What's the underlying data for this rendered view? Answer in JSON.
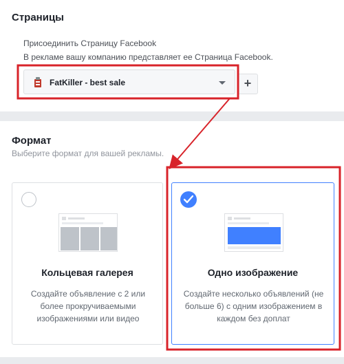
{
  "pages": {
    "title": "Страницы",
    "connect_label": "Присоединить Страницу Facebook",
    "description": "В рекламе вашу компанию представляет ее Страница Facebook.",
    "selected_page": "FatKiller - best sale",
    "add_label": "+"
  },
  "format": {
    "title": "Формат",
    "description": "Выберите формат для вашей рекламы.",
    "options": [
      {
        "title": "Кольцевая галерея",
        "description": "Создайте объявление с 2 или более прокручиваемыми изображениями или видео",
        "selected": false
      },
      {
        "title": "Одно изображение",
        "description": "Создайте несколько объявлений (не больше 6) с одним изображением в каждом без доплат",
        "selected": true
      }
    ]
  },
  "colors": {
    "accent": "#4080ff",
    "annotation": "#d8232a",
    "divider": "#e9ebee"
  },
  "icons": {
    "page": "page-avatar-icon",
    "dropdown": "chevron-down-icon",
    "check": "checkmark-icon"
  }
}
